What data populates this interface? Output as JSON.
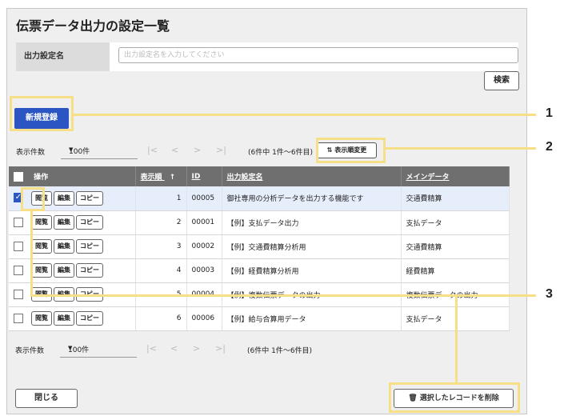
{
  "page": {
    "title": "伝票データ出力の設定一覧"
  },
  "search": {
    "label": "出力設定名",
    "placeholder": "出力設定名を入力してください",
    "button": "検索"
  },
  "new_button": "新規登録",
  "pager": {
    "label": "表示件数",
    "per_page": "100件",
    "first": "|<",
    "prev": "<",
    "next": ">",
    "last": ">|",
    "count": "(6件中 1件～6件目)"
  },
  "sort_button": "表示順変更",
  "table": {
    "headers": {
      "ops": "操作",
      "order": "表示順",
      "id": "ID",
      "name": "出力設定名",
      "main": "メインデータ"
    },
    "sort_arrow": "↑",
    "row_buttons": {
      "view": "閲覧",
      "edit": "編集",
      "copy": "コピー"
    },
    "rows": [
      {
        "checked": true,
        "order": "1",
        "id": "00005",
        "name": "御社専用の分析データを出力する機能です",
        "main": "交通費精算"
      },
      {
        "checked": false,
        "order": "2",
        "id": "00001",
        "name": "【例】支払データ出力",
        "main": "支払データ"
      },
      {
        "checked": false,
        "order": "3",
        "id": "00002",
        "name": "【例】交通費精算分析用",
        "main": "交通費精算"
      },
      {
        "checked": false,
        "order": "4",
        "id": "00003",
        "name": "【例】経費精算分析用",
        "main": "経費精算"
      },
      {
        "checked": false,
        "order": "5",
        "id": "00004",
        "name": "【例】複数伝票データの出力",
        "main": "複数伝票データの出力"
      },
      {
        "checked": false,
        "order": "6",
        "id": "00006",
        "name": "【例】給与合算用データ",
        "main": "支払データ"
      }
    ]
  },
  "footer": {
    "close": "閉じる",
    "delete": "選択したレコードを削除"
  },
  "callouts": [
    "1",
    "2",
    "3"
  ],
  "colors": {
    "primary": "#2a55c3",
    "highlight": "#f6df87",
    "header": "#6f6f6f"
  }
}
